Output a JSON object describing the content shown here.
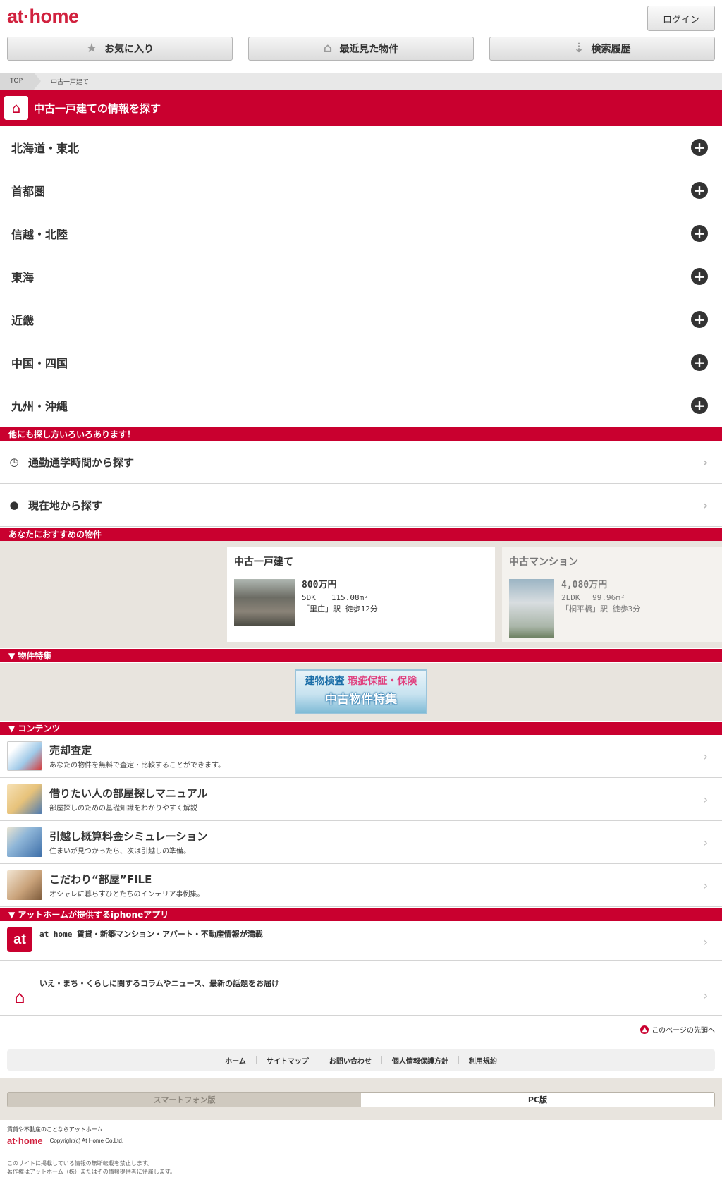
{
  "header": {
    "logo": "at·home",
    "login": "ログイン"
  },
  "nav": [
    {
      "icon": "star-icon",
      "glyph": "★",
      "label": "お気に入り"
    },
    {
      "icon": "house-icon",
      "glyph": "⌂",
      "label": "最近見た物件"
    },
    {
      "icon": "inbox-icon",
      "glyph": "⇣",
      "label": "検索履歴"
    }
  ],
  "breadcrumb": {
    "top": "TOP",
    "current": "中古一戸建て"
  },
  "title": "中古一戸建ての情報を探す",
  "regions": [
    "北海道・東北",
    "首都圏",
    "信越・北陸",
    "東海",
    "近畿",
    "中国・四国",
    "九州・沖縄"
  ],
  "other_header": "他にも探し方いろいろあります！",
  "other": [
    {
      "icon": "clock-icon",
      "glyph": "◷",
      "label": "通勤通学時間から探す"
    },
    {
      "icon": "location-pin-icon",
      "glyph": "●",
      "label": "現在地から探す"
    }
  ],
  "rec_header": "あなたにおすすめの物件",
  "recommendations": [
    {
      "type": "中古一戸建て",
      "price": "800万円",
      "spec": "5DK　　115.08m²",
      "access": "「里庄」駅 徒歩12分"
    },
    {
      "type": "中古マンション",
      "price": "4,080万円",
      "spec": "2LDK　 99.96m²",
      "access": "「桐平橋」駅 徒歩3分"
    }
  ],
  "feature_header": "▼ 物件特集",
  "banner": {
    "line1a": "建物検査",
    "line1b": "瑕疵保証・保険",
    "line2": "中古物件特集"
  },
  "contents_header": "▼ コンテンツ",
  "contents": [
    {
      "title": "売却査定",
      "desc": "あなたの物件を無料で査定・比較することができます。",
      "color": "#9fc9e8"
    },
    {
      "title": "借りたい人の部屋探しマニュアル",
      "desc": "部屋探しのための基礎知識をわかりやすく解説",
      "color": "#e7c27a"
    },
    {
      "title": "引越し概算料金シミュレーション",
      "desc": "住まいが見つかったら、次は引越しの準備。",
      "color": "#3d6ea8"
    },
    {
      "title": "こだわり“部屋”FILE",
      "desc": "オシャレに暮らすひとたちのインテリア事例集。",
      "color": "#c9a27a"
    }
  ],
  "apps_header": "▼ アットホームが提供するiphoneアプリ",
  "apps": [
    {
      "logo": "at",
      "label": "at home 賃貸・新築マンション・アパート・不動産情報が満載"
    },
    {
      "logo": "",
      "label": "いえ・まち・くらしに関するコラムやニュース、最新の話題をお届け"
    }
  ],
  "pagetop": "このページの先頭へ",
  "footer_links": [
    "ホーム",
    "サイトマップ",
    "お問い合わせ",
    "個人情報保護方針",
    "利用規約"
  ],
  "switch": {
    "sp": "スマートフォン版",
    "pc": "PC版"
  },
  "footer": {
    "tagline": "賃貸や不動産のことならアットホーム",
    "logo": "at·home",
    "copyright": "Copyright(c) At Home Co.Ltd.",
    "note1": "このサイトに掲載している情報の無断転載を禁止します。",
    "note2": "著作権はアットホーム（株）またはその情報提供者に帰属します。"
  }
}
